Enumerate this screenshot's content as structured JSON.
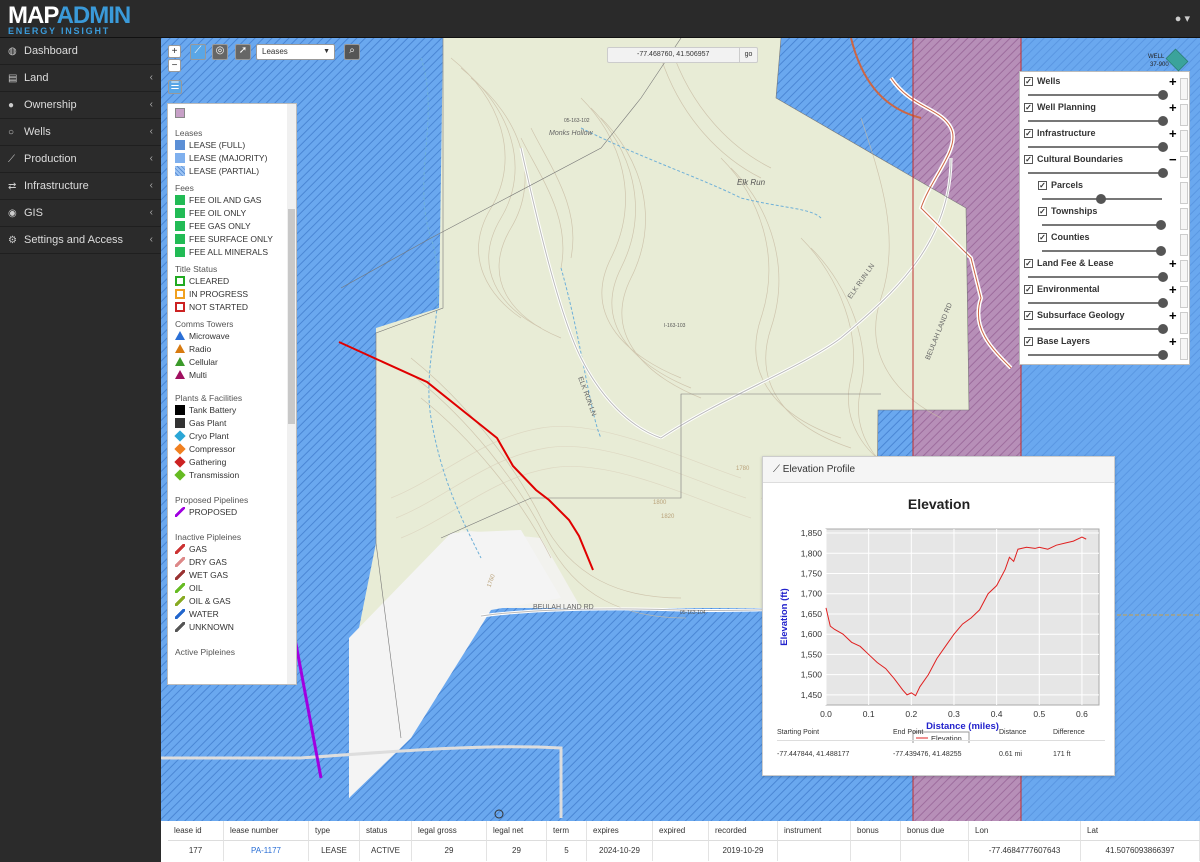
{
  "app": {
    "logo_main_a": "MAP",
    "logo_main_b": "ADMIN",
    "logo_sub": "ENERGY INSIGHT",
    "user_icon": "user-icon ▾"
  },
  "nav": [
    {
      "label": "Dashboard",
      "icon": "dashboard-icon",
      "glyph": "◍",
      "chevron": ""
    },
    {
      "label": "Land",
      "icon": "file-icon",
      "glyph": "▤",
      "chevron": "‹"
    },
    {
      "label": "Ownership",
      "icon": "user-icon",
      "glyph": "●",
      "chevron": "‹"
    },
    {
      "label": "Wells",
      "icon": "circle-icon",
      "glyph": "○",
      "chevron": "‹"
    },
    {
      "label": "Production",
      "icon": "chart-icon",
      "glyph": "⟋",
      "chevron": "‹"
    },
    {
      "label": "Infrastructure",
      "icon": "exchange-icon",
      "glyph": "⇄",
      "chevron": "‹"
    },
    {
      "label": "GIS",
      "icon": "globe-icon",
      "glyph": "◉",
      "chevron": "‹"
    },
    {
      "label": "Settings and Access",
      "icon": "gears-icon",
      "glyph": "⚙",
      "chevron": "‹"
    }
  ],
  "toolbar": {
    "zoom_in": "+",
    "zoom_out": "−",
    "layer_select": "Leases",
    "coords": "-77.468760, 41.506957",
    "go": "go"
  },
  "map_labels": {
    "monks": "Monks Hollow",
    "elkrun": "Elk Run",
    "elkrunln": "ELK RUN LN",
    "elkrunln2": "ELK RUN LN",
    "beulah": "BEULAH LAND RD",
    "beulah2": "BEULAH LAND RD",
    "c1780": "1780",
    "c1800": "1800",
    "c1820": "1820",
    "c1760": "1760",
    "id1": "05-163-102",
    "id2": "I-163-103",
    "id3": "05-163-104",
    "wells_tag": "WELL",
    "wells_tag2": "37-900"
  },
  "legend": {
    "leases_h": "Leases",
    "leases": [
      "LEASE (FULL)",
      "LEASE (MAJORITY)",
      "LEASE (PARTIAL)"
    ],
    "fees_h": "Fees",
    "fees": [
      "FEE OIL AND GAS",
      "FEE OIL ONLY",
      "FEE GAS ONLY",
      "FEE SURFACE ONLY",
      "FEE ALL MINERALS"
    ],
    "title_h": "Title Status",
    "title": [
      "CLEARED",
      "IN PROGRESS",
      "NOT STARTED"
    ],
    "comms_h": "Comms Towers",
    "comms": [
      "Microwave",
      "Radio",
      "Cellular",
      "Multi"
    ],
    "plants_h": "Plants & Facilities",
    "plants": [
      "Tank Battery",
      "Gas Plant",
      "Cryo Plant",
      "Compressor",
      "Gathering",
      "Transmission"
    ],
    "proposed_h": "Proposed Pipelines",
    "proposed": [
      "PROPOSED"
    ],
    "inactive_h": "Inactive Pipleines",
    "inactive": [
      "GAS",
      "DRY GAS",
      "WET GAS",
      "OIL",
      "OIL & GAS",
      "WATER",
      "UNKNOWN"
    ],
    "active_h": "Active Pipleines"
  },
  "layers": [
    {
      "label": "Wells",
      "indent": false,
      "plus": "+"
    },
    {
      "label": "Well Planning",
      "indent": false,
      "plus": "+"
    },
    {
      "label": "Infrastructure",
      "indent": false,
      "plus": "+"
    },
    {
      "label": "Cultural Boundaries",
      "indent": false,
      "plus": "−"
    },
    {
      "label": "Parcels",
      "indent": true,
      "plus": ""
    },
    {
      "label": "Townships",
      "indent": true,
      "plus": ""
    },
    {
      "label": "Counties",
      "indent": true,
      "plus": ""
    },
    {
      "label": "Land Fee & Lease",
      "indent": false,
      "plus": "+"
    },
    {
      "label": "Environmental",
      "indent": false,
      "plus": "+"
    },
    {
      "label": "Subsurface Geology",
      "indent": false,
      "plus": "+"
    },
    {
      "label": "Base Layers",
      "indent": false,
      "plus": "+"
    }
  ],
  "layer_opacity": [
    1,
    1,
    1,
    1,
    0.5,
    1,
    1,
    1,
    1,
    1,
    1
  ],
  "elevation": {
    "panel_title": "Elevation Profile",
    "table_headers": [
      "Starting Point",
      "End Point",
      "Distance",
      "Difference"
    ],
    "table_row": [
      "-77.447844, 41.488177",
      "-77.439476, 41.48255",
      "0.61 mi",
      "171 ft"
    ]
  },
  "chart_data": {
    "type": "line",
    "title": "Elevation",
    "xlabel": "Distance (miles)",
    "ylabel": "Elevation (ft)",
    "xlim": [
      0,
      0.64
    ],
    "ylim": [
      1425,
      1860
    ],
    "xticks": [
      "0.0",
      "0.1",
      "0.2",
      "0.3",
      "0.4",
      "0.5",
      "0.6"
    ],
    "yticks": [
      "1,450",
      "1,500",
      "1,550",
      "1,600",
      "1,650",
      "1,700",
      "1,750",
      "1,800",
      "1,850"
    ],
    "grid": true,
    "legend": "bottom",
    "series": [
      {
        "name": "Elevation",
        "color": "#e02020",
        "x": [
          0,
          0.01,
          0.02,
          0.04,
          0.06,
          0.08,
          0.1,
          0.12,
          0.14,
          0.16,
          0.18,
          0.19,
          0.2,
          0.21,
          0.22,
          0.24,
          0.26,
          0.28,
          0.3,
          0.32,
          0.34,
          0.36,
          0.38,
          0.4,
          0.42,
          0.43,
          0.44,
          0.45,
          0.47,
          0.49,
          0.5,
          0.52,
          0.54,
          0.56,
          0.58,
          0.6,
          0.61
        ],
        "y": [
          1665,
          1620,
          1612,
          1600,
          1580,
          1570,
          1550,
          1530,
          1515,
          1490,
          1462,
          1450,
          1455,
          1448,
          1470,
          1500,
          1540,
          1570,
          1600,
          1625,
          1640,
          1660,
          1700,
          1720,
          1760,
          1790,
          1780,
          1810,
          1815,
          1812,
          1815,
          1810,
          1820,
          1825,
          1830,
          1840,
          1835
        ]
      }
    ]
  },
  "table": {
    "headers": [
      "lease id",
      "lease number",
      "type",
      "status",
      "legal gross",
      "legal net",
      "term",
      "expires",
      "expired",
      "recorded",
      "instrument",
      "bonus",
      "bonus due",
      "Lon",
      "Lat"
    ],
    "row": [
      "177",
      "PA-1177",
      "LEASE",
      "ACTIVE",
      "29",
      "29",
      "5",
      "2024-10-29",
      "",
      "2019-10-29",
      "",
      "",
      "",
      "-77.4684777607643",
      "41.5076093866397"
    ]
  },
  "colors": {
    "lease_full": "#5b8fd6",
    "lease_major": "#7fb0ee",
    "fee": "#22bb55",
    "cleared": "#22aa22",
    "progress": "#f0a020",
    "notstarted": "#cc2222",
    "pipeline": "#e00000",
    "proposed": "#a000e0"
  }
}
